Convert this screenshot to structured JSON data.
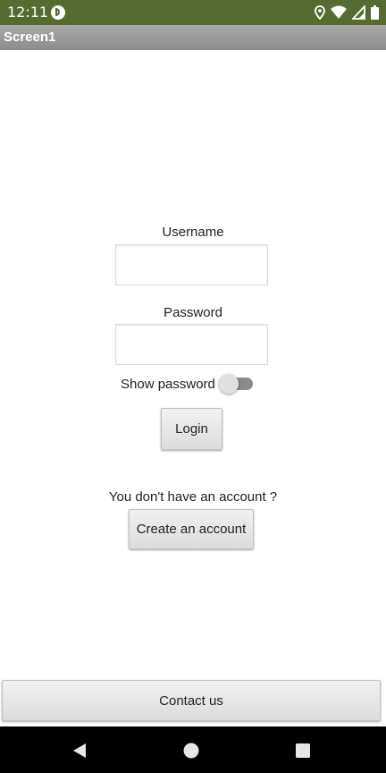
{
  "status_bar": {
    "time": "12:11",
    "app_icon": "app-notification-icon",
    "icons": [
      "location-icon",
      "wifi-icon",
      "cell-signal-icon",
      "battery-icon"
    ],
    "color": "#556b2f"
  },
  "title_bar": {
    "title": "Screen1"
  },
  "form": {
    "username_label": "Username",
    "username_value": "",
    "password_label": "Password",
    "password_value": "",
    "show_password_label": "Show password",
    "show_password_on": false,
    "login_label": "Login"
  },
  "account": {
    "prompt": "You don't have an account ?",
    "create_label": "Create an account"
  },
  "footer": {
    "contact_label": "Contact us"
  },
  "nav_bar": {
    "buttons": [
      "back-icon",
      "home-icon",
      "recents-icon"
    ]
  }
}
